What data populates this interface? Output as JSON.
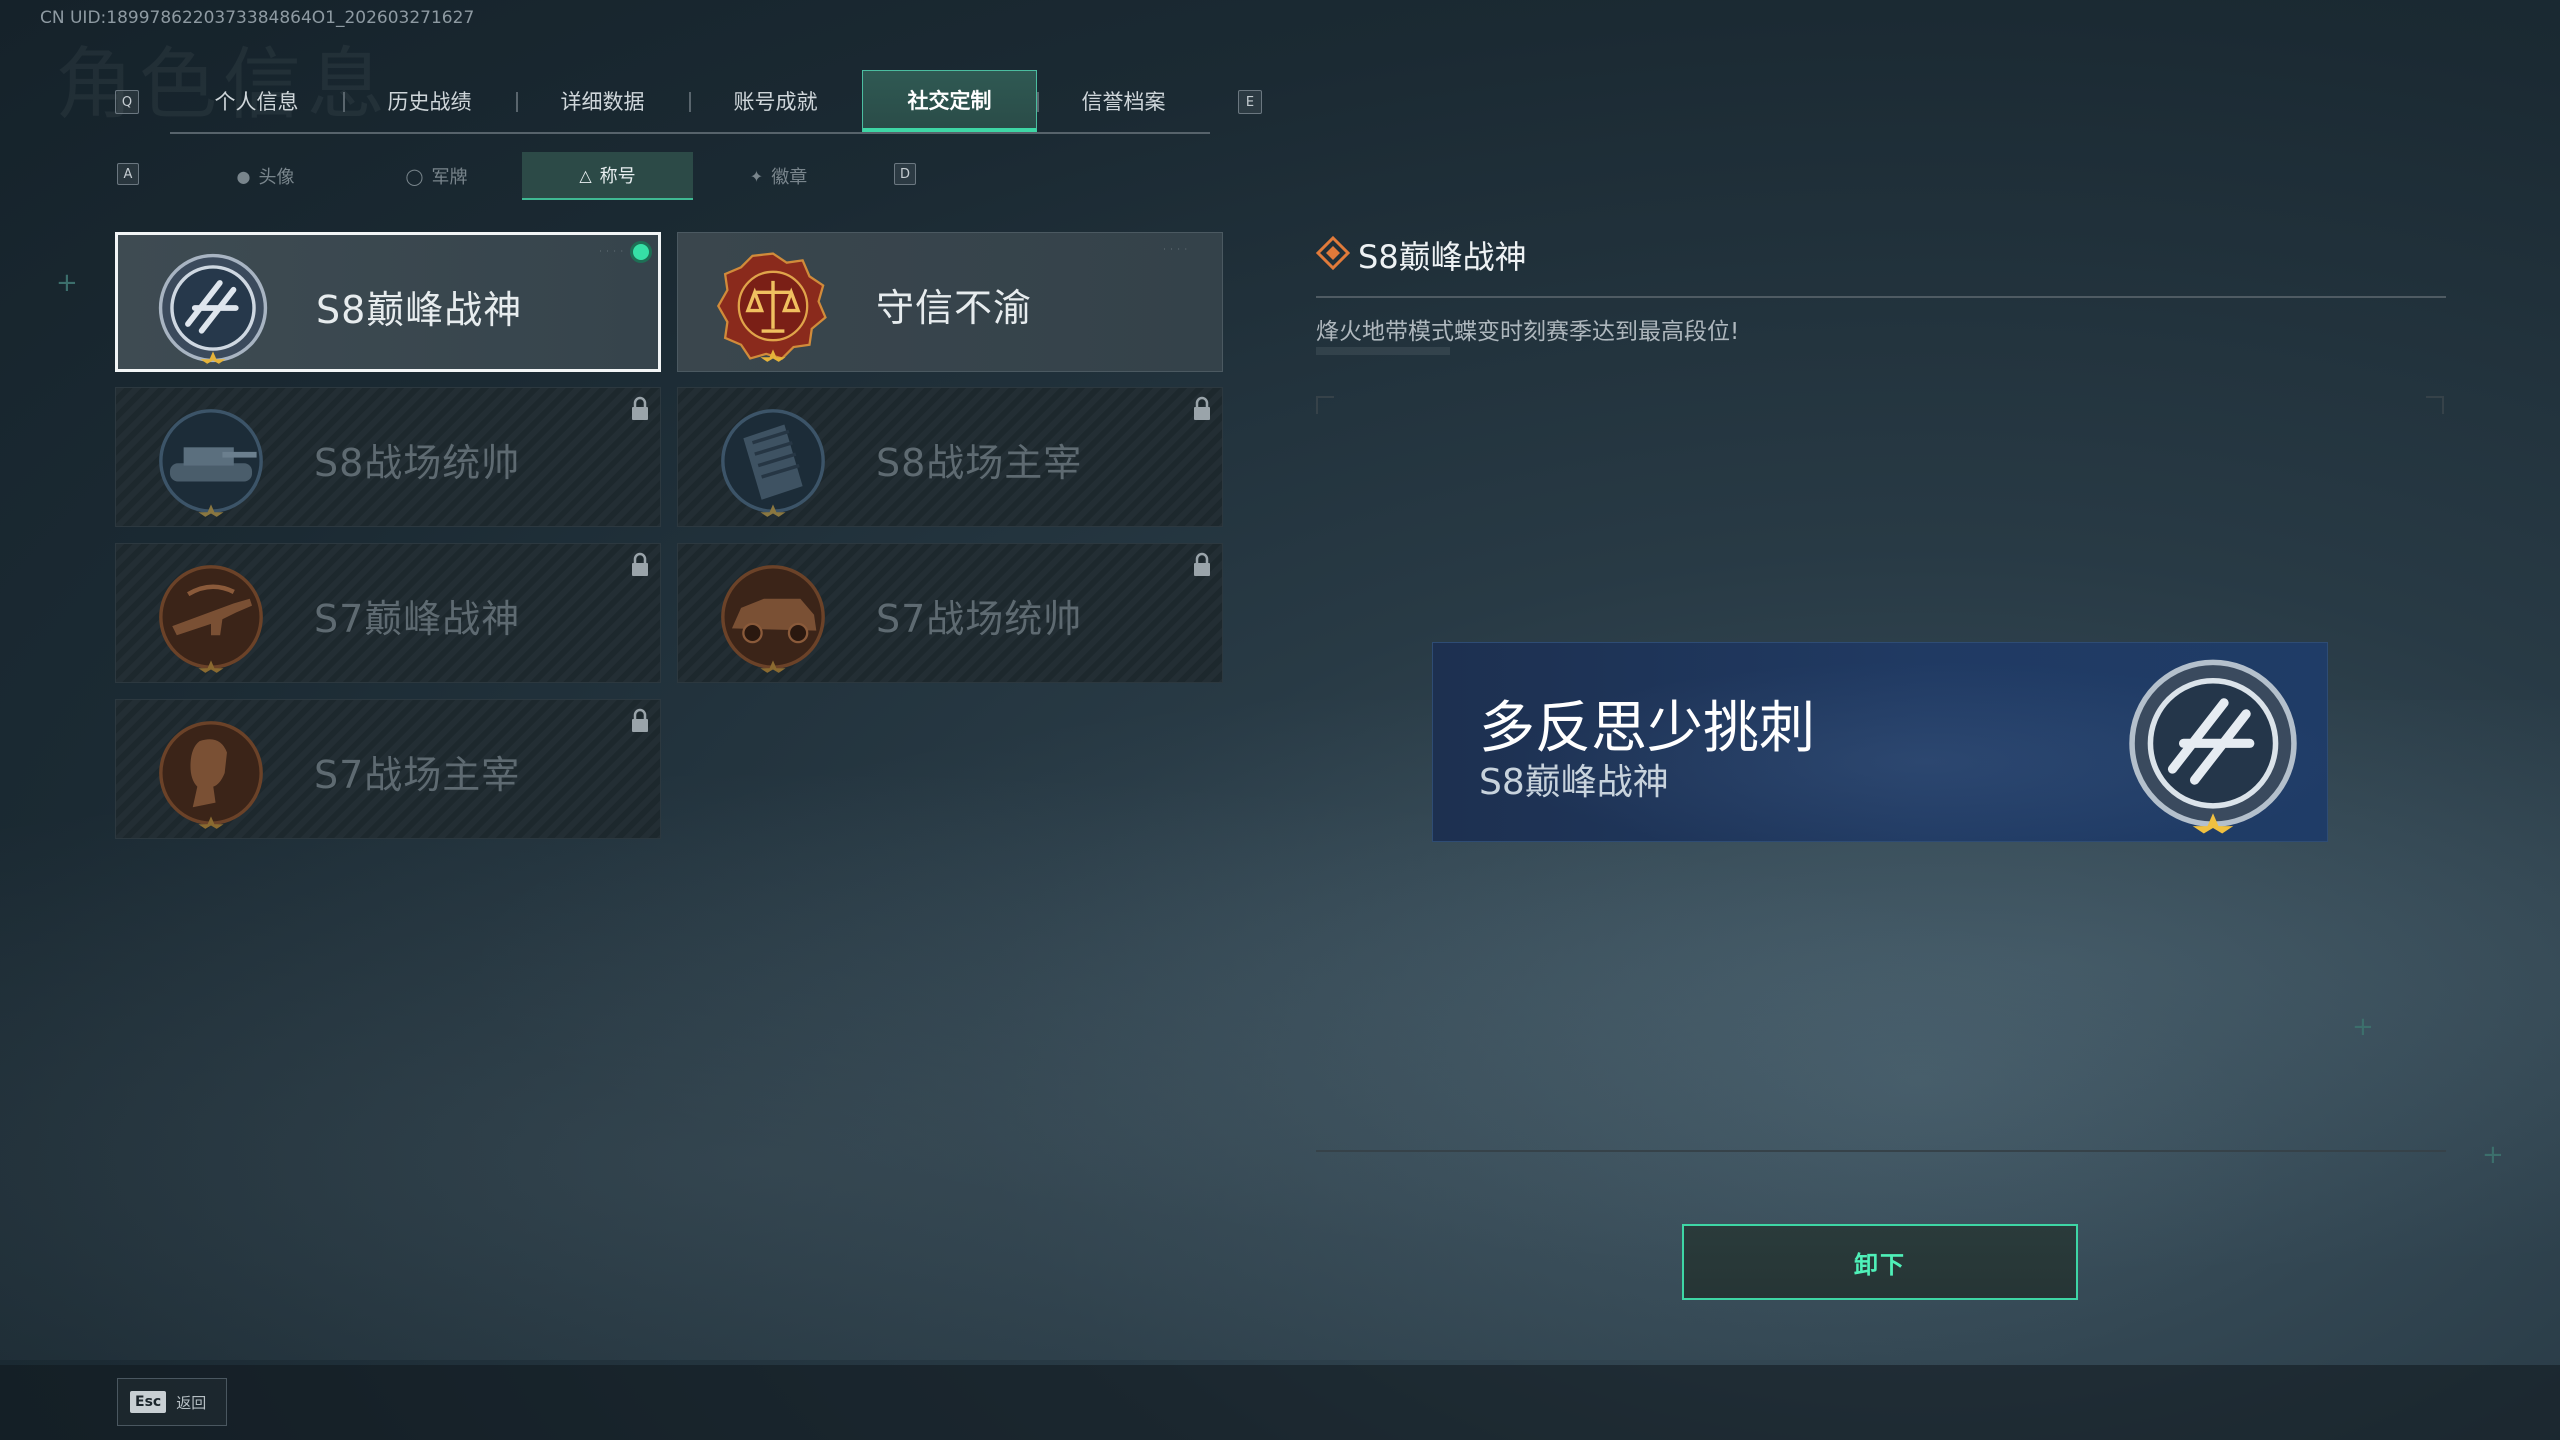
{
  "uid": "CN UID:1899786220373384864O1_202603271627",
  "watermark": "角色信息",
  "keys": {
    "prev_tab": "Q",
    "next_tab": "E",
    "prev_sub": "A",
    "next_sub": "D"
  },
  "tabs": [
    {
      "label": "个人信息"
    },
    {
      "label": "历史战绩"
    },
    {
      "label": "详细数据"
    },
    {
      "label": "账号成就"
    },
    {
      "label": "社交定制",
      "active": true
    },
    {
      "label": "信誉档案"
    }
  ],
  "subtabs": [
    {
      "label": "头像",
      "icon": "person-icon"
    },
    {
      "label": "军牌",
      "icon": "dogtag-icon"
    },
    {
      "label": "称号",
      "icon": "title-icon",
      "active": true
    },
    {
      "label": "徽章",
      "icon": "emblem-icon"
    }
  ],
  "titles": [
    {
      "name": "S8巅峰战神",
      "badge": "s8-peak-badge-icon",
      "unlocked": true,
      "selected": true
    },
    {
      "name": "守信不渝",
      "badge": "scales-badge-icon",
      "unlocked": true
    },
    {
      "name": "S8战场统帅",
      "badge": "tank-badge-icon",
      "unlocked": false
    },
    {
      "name": "S8战场主宰",
      "badge": "building-badge-icon",
      "unlocked": false
    },
    {
      "name": "S7巅峰战神",
      "badge": "rifle-badge-icon",
      "unlocked": false
    },
    {
      "name": "S7战场统帅",
      "badge": "vehicle-badge-icon",
      "unlocked": false
    },
    {
      "name": "S7战场主宰",
      "badge": "soldier-badge-icon",
      "unlocked": false
    }
  ],
  "detail": {
    "title": "S8巅峰战神",
    "description": "烽火地带模式蝶变时刻赛季达到最高段位!"
  },
  "preview": {
    "player_name": "多反思少挑刺",
    "title": "S8巅峰战神"
  },
  "unequip_label": "卸下",
  "esc": {
    "key": "Esc",
    "label": "返回"
  },
  "colors": {
    "accent": "#3ed6a5",
    "banner": "#203a63"
  }
}
